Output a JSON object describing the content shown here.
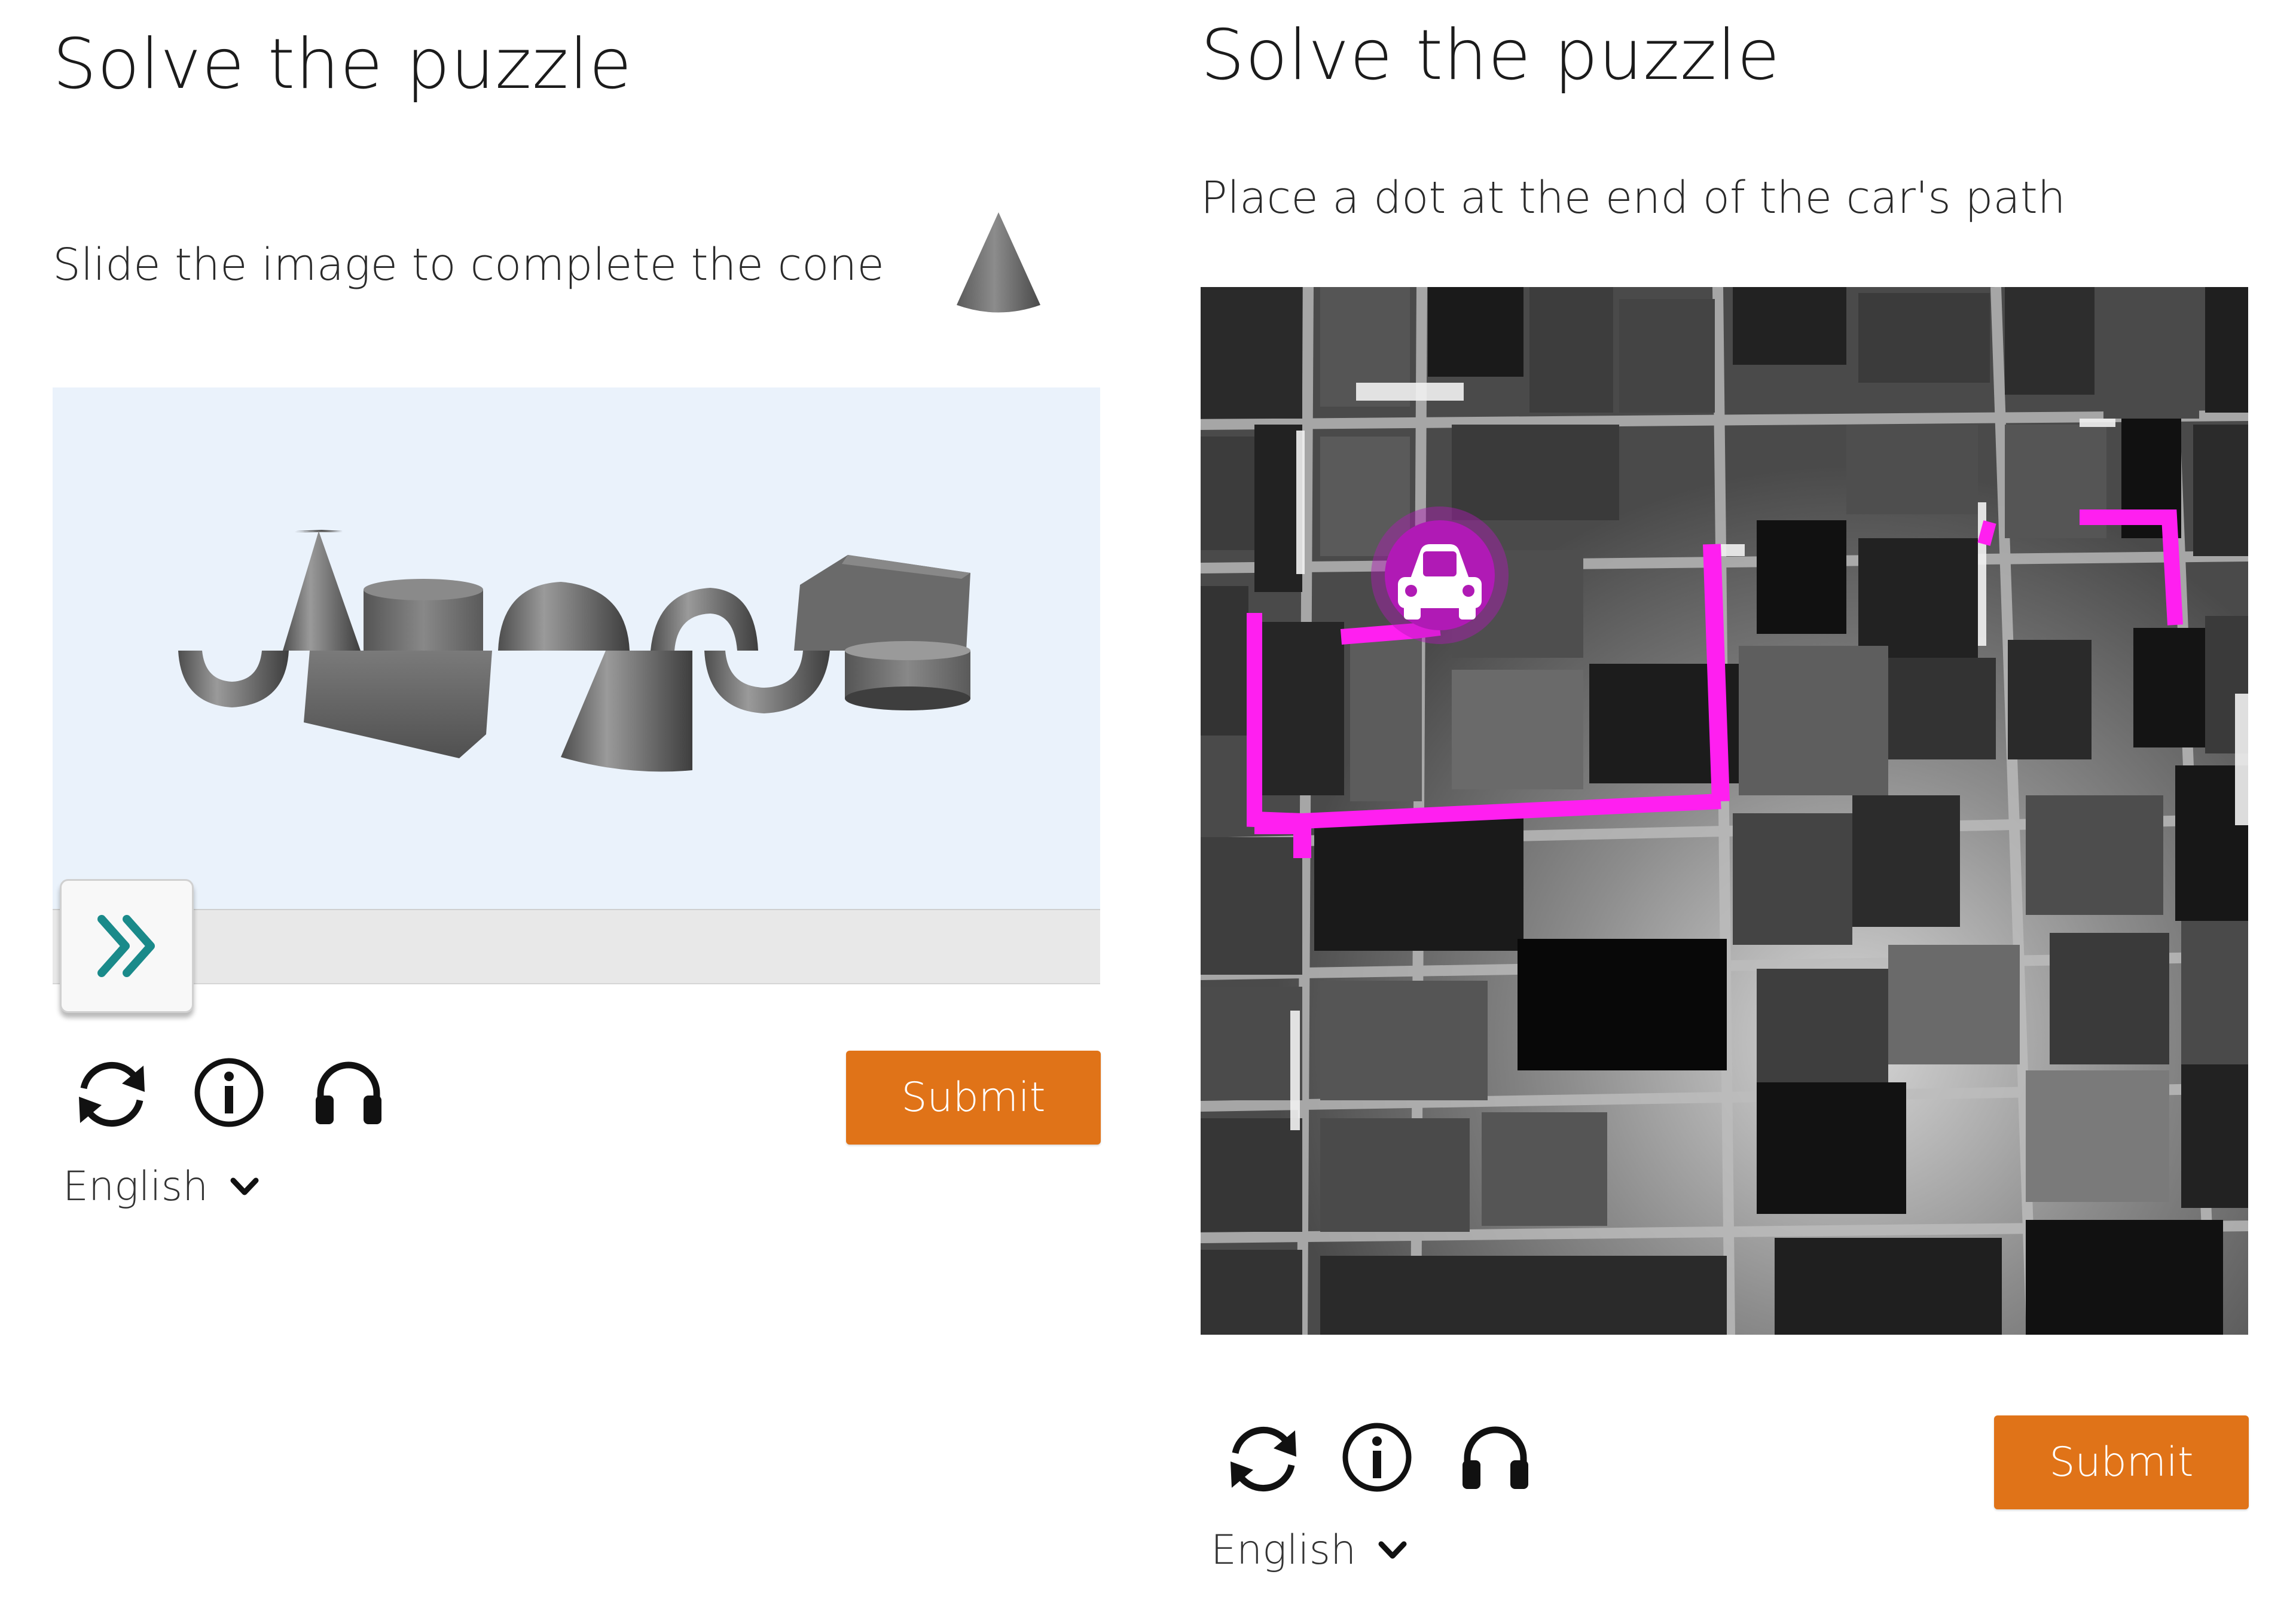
{
  "left_puzzle": {
    "title": "Solve the puzzle",
    "instruction": "Slide the image to complete the cone",
    "hint_icon": "cone-icon",
    "slider_icon": "double-chevron-right-icon",
    "slider_position": 0,
    "toolbar": [
      "refresh-icon",
      "info-icon",
      "audio-headphones-icon"
    ],
    "submit_label": "Submit",
    "language": "English",
    "colors": {
      "canvas_bg": "#eaf2fb",
      "slider_icon": "#1a8a8a",
      "submit": "#e07318"
    }
  },
  "right_puzzle": {
    "title": "Solve the puzzle",
    "instruction": "Place a dot at the end of the car's path",
    "car_icon": "car-icon",
    "toolbar": [
      "refresh-icon",
      "info-icon",
      "audio-headphones-icon"
    ],
    "submit_label": "Submit",
    "language": "English",
    "colors": {
      "path": "#ff1ff0",
      "car_badge": "#b01ab5",
      "submit": "#e07318"
    }
  }
}
